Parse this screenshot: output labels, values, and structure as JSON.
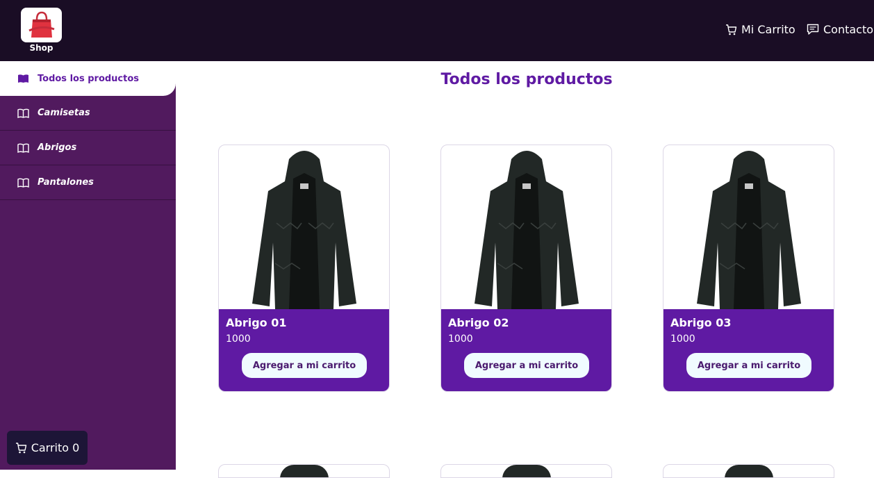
{
  "header": {
    "logo_text": "Shop",
    "nav": [
      {
        "label": "Mi Carrito",
        "icon": "cart-icon"
      },
      {
        "label": "Contacto",
        "icon": "chat-icon"
      }
    ]
  },
  "sidebar": {
    "items": [
      {
        "label": "Todos los productos",
        "icon": "book-icon",
        "active": true
      },
      {
        "label": "Camisetas",
        "icon": "book-icon",
        "active": false
      },
      {
        "label": "Abrigos",
        "icon": "book-icon",
        "active": false
      },
      {
        "label": "Pantalones",
        "icon": "book-icon",
        "active": false
      }
    ],
    "cart_button": "Carrito 0"
  },
  "main": {
    "title": "Todos los productos",
    "products": [
      {
        "name": "Abrigo 01",
        "price": "1000",
        "button": "Agregar a mi carrito"
      },
      {
        "name": "Abrigo 02",
        "price": "1000",
        "button": "Agregar a mi carrito"
      },
      {
        "name": "Abrigo 03",
        "price": "1000",
        "button": "Agregar a mi carrito"
      }
    ]
  },
  "colors": {
    "topbar": "#1a0d25",
    "sidebar": "#511a5e",
    "accent": "#5f1aa3",
    "button_bg": "#f0fbff"
  }
}
